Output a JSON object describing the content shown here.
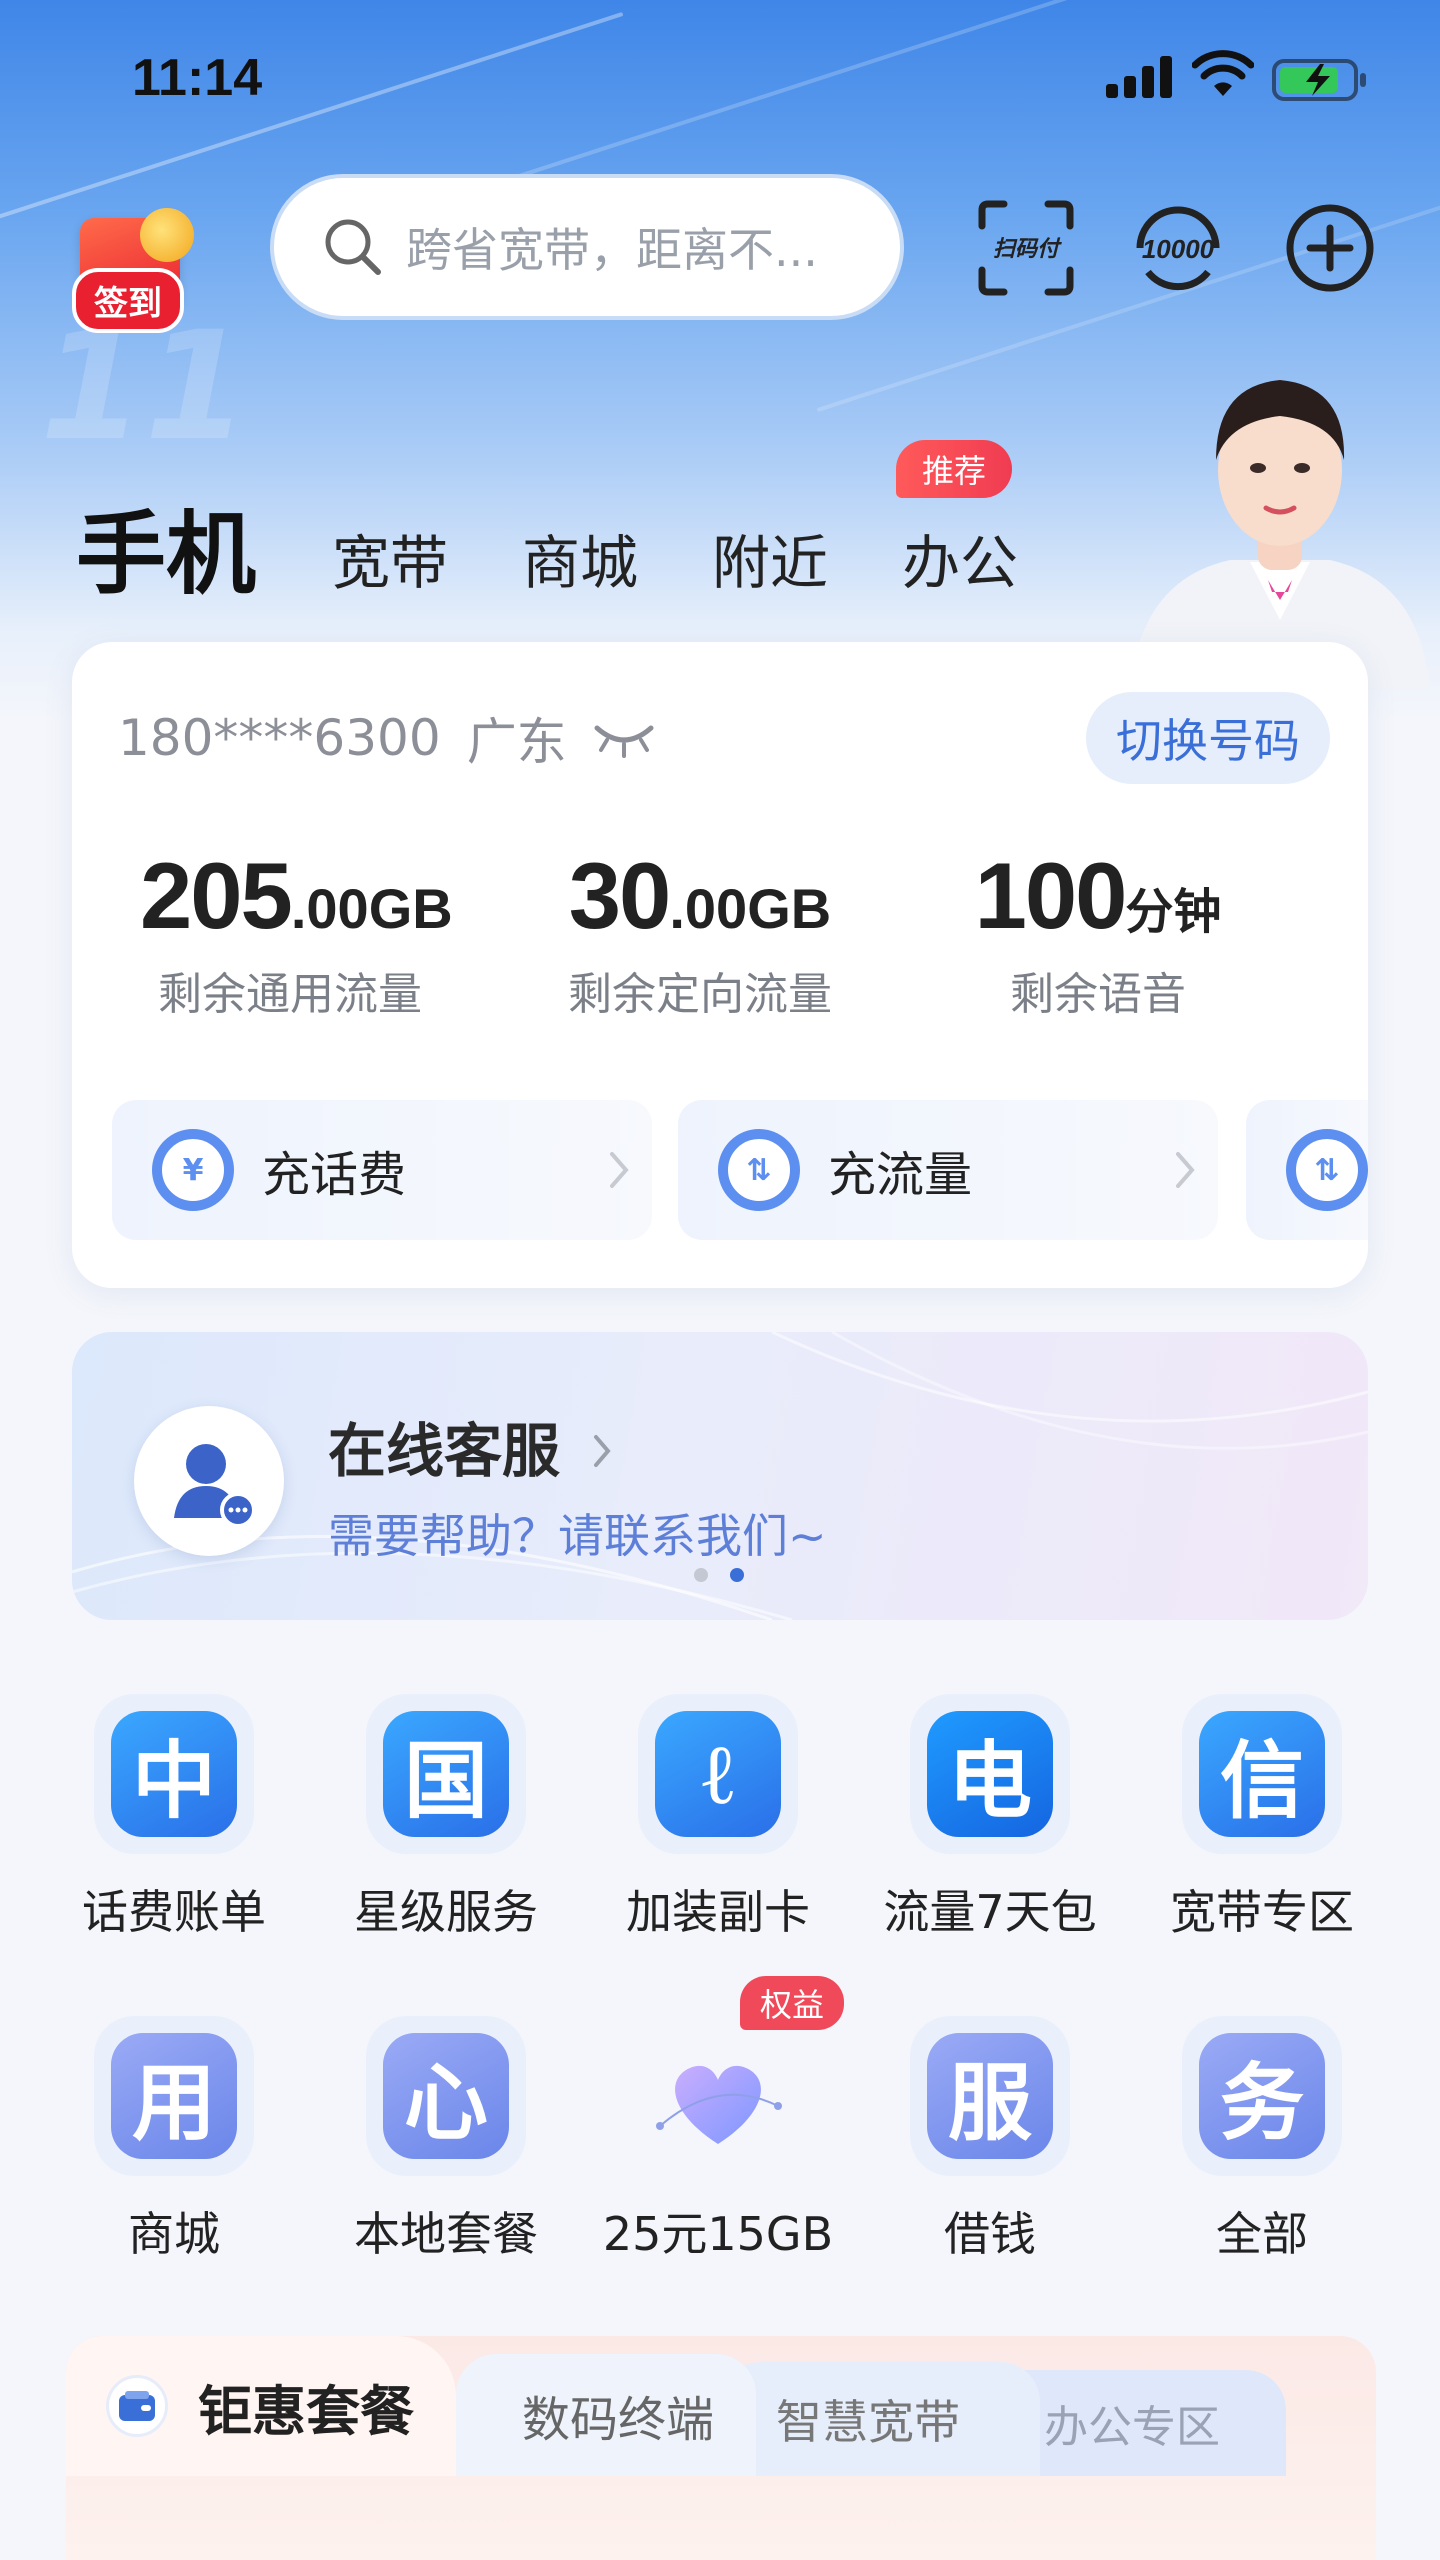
{
  "status_bar": {
    "time": "11:14"
  },
  "top_bar": {
    "signin_label": "签到",
    "search_placeholder": "跨省宽带，距离不...",
    "scan_pay_label": "扫码付",
    "hotline_label": "10000"
  },
  "tabs": [
    {
      "label": "手机",
      "active": true
    },
    {
      "label": "宽带",
      "active": false
    },
    {
      "label": "商城",
      "active": false
    },
    {
      "label": "附近",
      "active": false
    },
    {
      "label": "办公",
      "active": false,
      "badge": "推荐"
    }
  ],
  "account": {
    "number": "180****6300",
    "province": "广东",
    "switch_label": "切换号码",
    "stats": [
      {
        "value": "205",
        "decimal": ".00GB",
        "label": "剩余通用流量"
      },
      {
        "value": "30",
        "decimal": ".00GB",
        "label": "剩余定向流量"
      },
      {
        "value": "100",
        "decimal": "分钟",
        "label": "剩余语音"
      }
    ],
    "quick_actions": [
      {
        "label": "充话费",
        "icon": "yuan-icon"
      },
      {
        "label": "充流量",
        "icon": "data-drop-icon"
      }
    ]
  },
  "service_banner": {
    "title": "在线客服",
    "subtitle": "需要帮助？请联系我们~",
    "page_count": 2,
    "active_page": 2
  },
  "grid": {
    "row1": [
      {
        "label": "话费账单",
        "glyph": "中"
      },
      {
        "label": "星级服务",
        "glyph": "国"
      },
      {
        "label": "加装副卡",
        "glyph": "ℓ"
      },
      {
        "label": "流量7天包",
        "glyph": "电"
      },
      {
        "label": "宽带专区",
        "glyph": "信"
      }
    ],
    "row2": [
      {
        "label": "商城",
        "glyph": "用"
      },
      {
        "label": "本地套餐",
        "glyph": "心"
      },
      {
        "label": "25元15GB",
        "glyph": "",
        "badge": "权益"
      },
      {
        "label": "借钱",
        "glyph": "服"
      },
      {
        "label": "全部",
        "glyph": "务"
      }
    ]
  },
  "bottom_tabs": [
    "钜惠套餐",
    "数码终端",
    "智慧宽带",
    "办公专区"
  ],
  "colors": {
    "accent": "#3a6fd8",
    "badge_red": "#f04a5a",
    "tile_blue": "#2f8ff0",
    "tile_lavender": "#7f96ee"
  }
}
